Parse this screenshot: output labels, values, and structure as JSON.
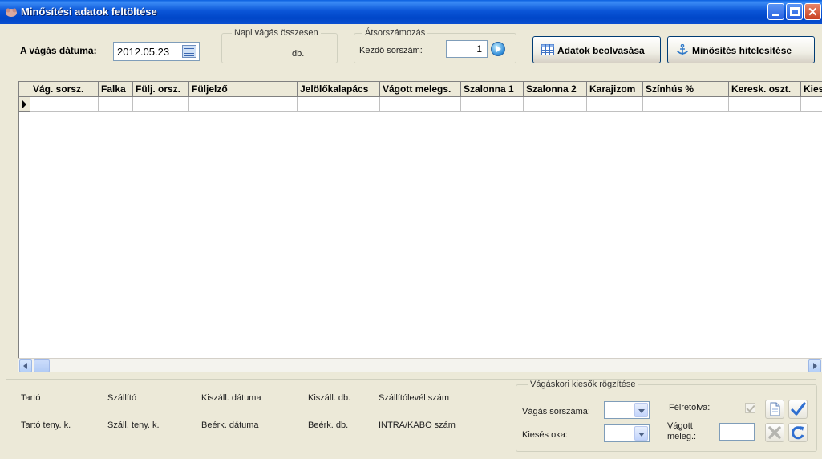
{
  "window": {
    "title": "Minősítési adatok feltöltése"
  },
  "top": {
    "date_label": "A vágás dátuma:",
    "date_value": "2012.05.23",
    "daily_group_label": "Napi vágás összesen",
    "daily_unit": "db.",
    "renumber_group_label": "Átsorszámozás",
    "start_number_label": "Kezdő sorszám:",
    "start_number_value": "1",
    "read_data_button": "Adatok beolvasása",
    "authenticate_button": "Minősítés hitelesítése"
  },
  "grid": {
    "columns": [
      "Vág. sorsz.",
      "Falka",
      "Fülj. orsz.",
      "Füljelző",
      "Jelölőkalapács",
      "Vágott melegs.",
      "Szalonna 1",
      "Szalonna 2",
      "Karajizom",
      "Színhús %",
      "Keresk. oszt.",
      "Kies"
    ]
  },
  "bottom": {
    "tarto": "Tartó",
    "szallito": "Szállító",
    "kiszall_datuma": "Kiszáll. dátuma",
    "kiszall_db": "Kiszáll. db.",
    "szallitolevel_szam": "Szállítólevél szám",
    "tarto_teny": "Tartó teny. k.",
    "szall_teny": "Száll. teny. k.",
    "beerk_datuma": "Beérk. dátuma",
    "beerk_db": "Beérk. db.",
    "intra_kabo": "INTRA/KABO szám",
    "losses_group": "Vágáskori kiesők rögzítése",
    "vagas_sorszama": "Vágás sorszáma:",
    "kieses_oka": "Kiesés oka:",
    "felretolva": "Félretolva:",
    "vagott_meleg_1": "Vágott",
    "vagott_meleg_2": "meleg.:"
  }
}
